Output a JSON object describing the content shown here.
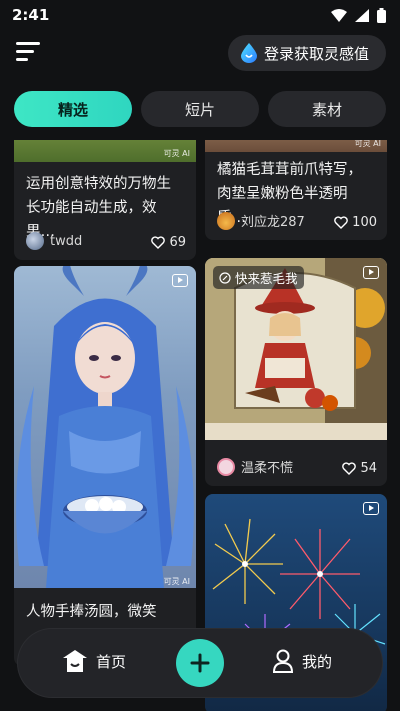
{
  "status_bar": {
    "time": "2:41"
  },
  "header": {
    "login_label": "登录获取灵感值"
  },
  "tabs": [
    {
      "label": "精选",
      "active": true
    },
    {
      "label": "短片",
      "active": false
    },
    {
      "label": "素材",
      "active": false
    }
  ],
  "cards": {
    "c1": {
      "title": "运用创意特效的万物生长功能自动生成，效果…",
      "user": "twdd",
      "likes": "69",
      "watermark": "可灵 AI"
    },
    "c2": {
      "title": "橘猫毛茸茸前爪特写，肉垫呈嫩粉色半透明质…",
      "user": "刘应龙287",
      "likes": "100",
      "watermark": "可灵 AI"
    },
    "c3": {
      "title": "人物手捧汤圆，微笑",
      "watermark": "可灵 AI"
    },
    "c4": {
      "tag": "快来惹毛我",
      "user": "温柔不慌",
      "likes": "54"
    },
    "c5": {}
  },
  "bottom_nav": {
    "home_label": "首页",
    "mine_label": "我的"
  },
  "colors": {
    "accent": "#36d7c0",
    "background": "#111214",
    "card": "#1f2023"
  }
}
